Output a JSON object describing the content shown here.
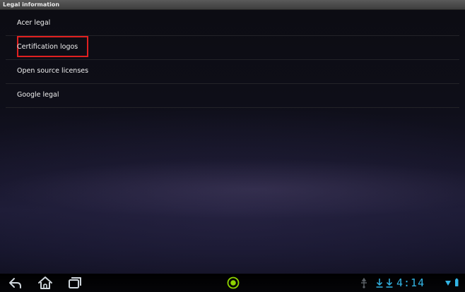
{
  "window": {
    "title": "Legal information"
  },
  "menu": {
    "items": [
      {
        "label": "Acer legal"
      },
      {
        "label": "Certification logos",
        "highlighted": true
      },
      {
        "label": "Open source licenses"
      },
      {
        "label": "Google legal"
      }
    ]
  },
  "system_bar": {
    "buttons": [
      "back-icon",
      "home-icon",
      "recent-apps-icon"
    ],
    "center_icon": "notification-dot-icon",
    "status_icons": [
      "usb-icon",
      "download-icon",
      "download-icon",
      "wifi-icon",
      "battery-icon"
    ],
    "clock": "4:14",
    "accent_color": "#33b5e5"
  },
  "colors": {
    "title_bar": "#4a4a4a",
    "highlight_box": "#e02020",
    "indicator_green": "#8fd400"
  }
}
